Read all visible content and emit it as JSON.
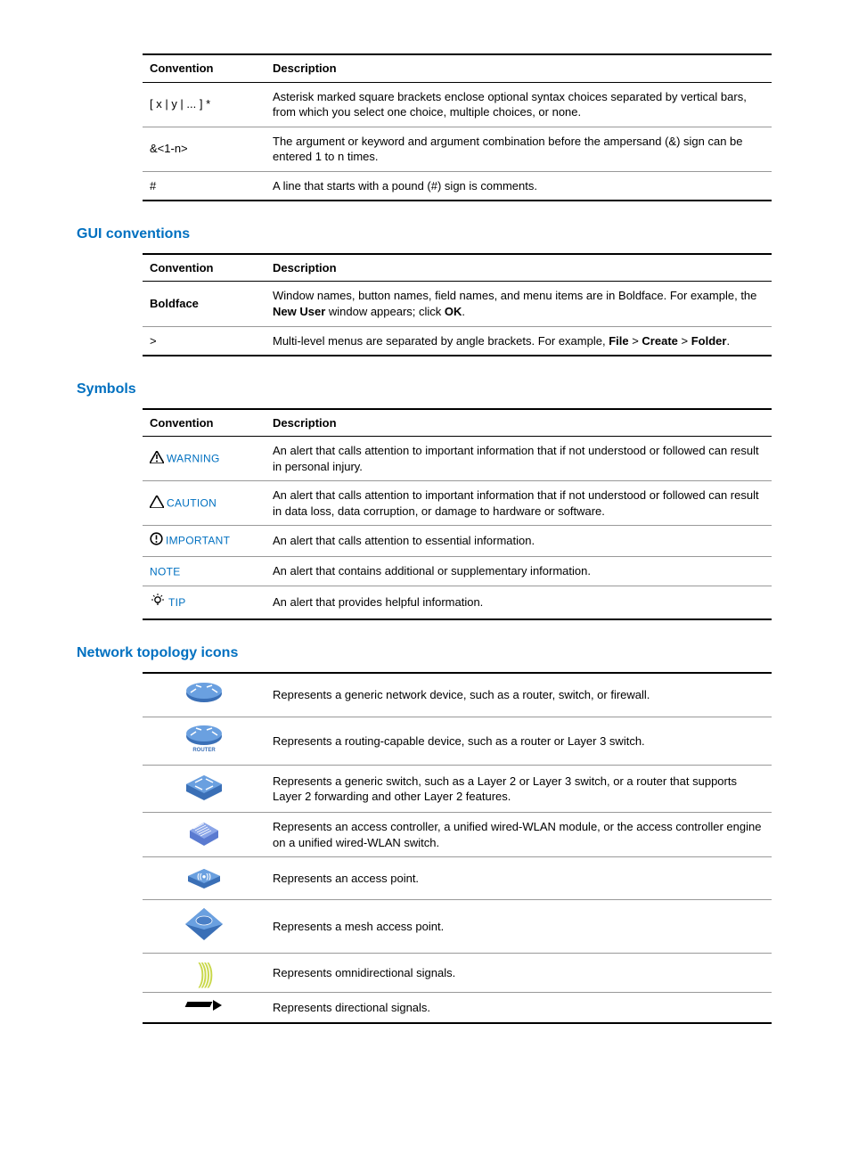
{
  "table1": {
    "head_conv": "Convention",
    "head_desc": "Description",
    "rows": [
      {
        "conv": "[ x | y | ... ] *",
        "desc": "Asterisk marked square brackets enclose optional syntax choices separated by vertical bars, from which you select one choice, multiple choices, or none."
      },
      {
        "conv": "&<1-n>",
        "desc": "The argument or keyword and argument combination before the ampersand (&) sign can be entered 1 to n times."
      },
      {
        "conv": "#",
        "desc": "A line that starts with a pound (#) sign is comments."
      }
    ]
  },
  "section_gui": "GUI conventions",
  "table2": {
    "head_conv": "Convention",
    "head_desc": "Description",
    "rows": [
      {
        "conv": "Boldface",
        "desc_pre": "Window names, button names, field names, and menu items are in Boldface. For example, the ",
        "b1": "New User",
        "mid": " window appears; click ",
        "b2": "OK",
        "post": "."
      },
      {
        "conv": ">",
        "desc_pre": "Multi-level menus are separated by angle brackets. For example, ",
        "b1": "File",
        "mid": " > ",
        "b2": "Create",
        "mid2": " > ",
        "b3": "Folder",
        "post": "."
      }
    ]
  },
  "section_symbols": "Symbols",
  "table3": {
    "head_conv": "Convention",
    "head_desc": "Description",
    "rows": [
      {
        "label": "WARNING",
        "desc": "An alert that calls attention to important information that if not understood or followed can result in personal injury."
      },
      {
        "label": "CAUTION",
        "desc": "An alert that calls attention to important information that if not understood or followed can result in data loss, data corruption, or damage to hardware or software."
      },
      {
        "label": "IMPORTANT",
        "desc": "An alert that calls attention to essential information."
      },
      {
        "label": "NOTE",
        "desc": "An alert that contains additional or supplementary information."
      },
      {
        "label": "TIP",
        "desc": "An alert that provides helpful information."
      }
    ]
  },
  "section_net": "Network topology icons",
  "table4": {
    "rows": [
      {
        "desc": "Represents a generic network device, such as a router, switch, or firewall."
      },
      {
        "desc": "Represents a routing-capable device, such as a router or Layer 3 switch."
      },
      {
        "desc": "Represents a generic switch, such as a Layer 2 or Layer 3 switch, or a router that supports Layer 2 forwarding and other Layer 2 features."
      },
      {
        "desc": "Represents an access controller, a unified wired-WLAN module, or the access controller engine on a unified wired-WLAN switch."
      },
      {
        "desc": "Represents an access point."
      },
      {
        "desc": "Represents a mesh access point."
      },
      {
        "desc": "Represents omnidirectional signals."
      },
      {
        "desc": "Represents directional signals."
      }
    ]
  }
}
